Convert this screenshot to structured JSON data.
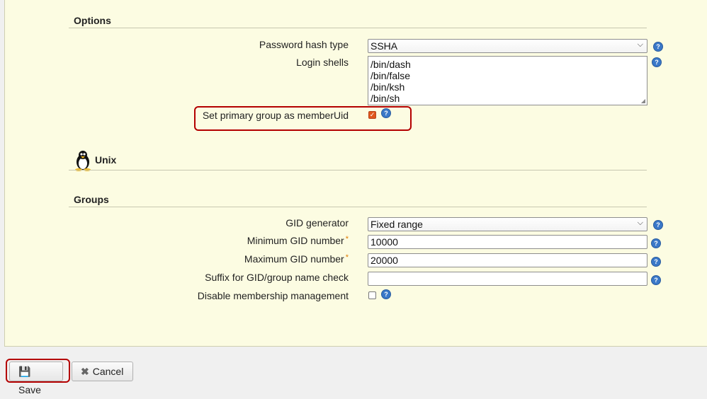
{
  "options": {
    "title": "Options",
    "password_hash_label": "Password hash type",
    "password_hash_value": "SSHA",
    "login_shells_label": "Login shells",
    "login_shells": [
      "/bin/dash",
      "/bin/false",
      "/bin/ksh",
      "/bin/sh"
    ],
    "primary_group_label": "Set primary group as memberUid",
    "primary_group_checked": true
  },
  "unix": {
    "title": "Unix"
  },
  "groups": {
    "title": "Groups",
    "gid_generator_label": "GID generator",
    "gid_generator_value": "Fixed range",
    "min_gid_label": "Minimum GID number",
    "min_gid_value": "10000",
    "max_gid_label": "Maximum GID number",
    "max_gid_value": "20000",
    "suffix_label": "Suffix for GID/group name check",
    "suffix_value": "",
    "disable_membership_label": "Disable membership management",
    "disable_membership_checked": false
  },
  "buttons": {
    "save": "Save",
    "cancel": "Cancel"
  },
  "icons": {
    "help": "help-icon",
    "linux": "tux-penguin-icon",
    "save": "floppy-disk-icon",
    "cancel": "x-icon"
  },
  "colors": {
    "panel": "#fcfce2",
    "highlight": "#b40000",
    "help": "#3a78c8",
    "required": "#e07b00"
  }
}
